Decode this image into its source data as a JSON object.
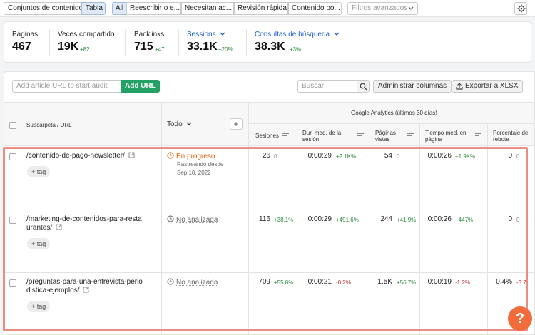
{
  "toolbar": {
    "sets_label": "Conjuntos de contenido",
    "table_label": "Tabla",
    "filters": [
      "All",
      "Reescribir o e...",
      "Necesitan ac...",
      "Revisión rápida",
      "Contenido po..."
    ],
    "advanced_filters": "Filtros avanzados"
  },
  "stats": {
    "pages_label": "Páginas",
    "pages_value": "467",
    "shared_label": "Veces compartido",
    "shared_value": "19K",
    "shared_delta": "+82",
    "backlinks_label": "Backlinks",
    "backlinks_value": "715",
    "backlinks_delta": "+47",
    "sessions_label": "Sessions",
    "sessions_value": "33.1K",
    "sessions_delta": "+20%",
    "queries_label": "Consultas de búsqueda",
    "queries_value": "38.3K",
    "queries_delta": "+3%"
  },
  "controls": {
    "url_placeholder": "Add article URL to start audit",
    "add_url": "Add URL",
    "search_placeholder": "Buscar",
    "manage_columns": "Administrar columnas",
    "export": "Exportar a XLSX"
  },
  "table": {
    "col_url": "Subcarpeta / URL",
    "col_todo": "Todo",
    "ga_group": "Google Analytics (últimos 30 días)",
    "col_sessions": "Sesiones",
    "col_duration": "Dur. med. de la sesión",
    "col_pages": "Páginas vistas",
    "col_time": "Tiempo med. en página",
    "col_bounce": "Porcentaje de rebote",
    "tag_label": "+ tag",
    "rows": [
      {
        "url": "/contenido-de-pago-newsletter/",
        "status": "En progreso",
        "status_sub": "Rastreando desde",
        "status_date": "Sep 10, 2022",
        "sessions": "26",
        "sessions_chg": "0",
        "duration": "0:00:29",
        "duration_chg": "+2.1K%",
        "pages": "54",
        "pages_chg": "0",
        "time": "0:00:26",
        "time_chg": "+1.9K%",
        "bounce": "0",
        "bounce_chg": "0"
      },
      {
        "url": "/marketing-de-contenidos-para-restaurantes/",
        "status": "No analizada",
        "sessions": "116",
        "sessions_chg": "+38.1%",
        "duration": "0:00:29",
        "duration_chg": "+491.6%",
        "pages": "244",
        "pages_chg": "+41.9%",
        "time": "0:00:26",
        "time_chg": "+447%",
        "bounce": "0",
        "bounce_chg": "0"
      },
      {
        "url": "/preguntas-para-una-entrevista-periodistica-ejemplos/",
        "status": "No analizada",
        "sessions": "709",
        "sessions_chg": "+55.8%",
        "duration": "0:00:21",
        "duration_chg": "-0.2%",
        "pages": "1.5K",
        "pages_chg": "+56.7%",
        "time": "0:00:19",
        "time_chg": "-1.2%",
        "bounce": "0.4%",
        "bounce_chg": "-3.7"
      }
    ]
  },
  "help_label": "?"
}
